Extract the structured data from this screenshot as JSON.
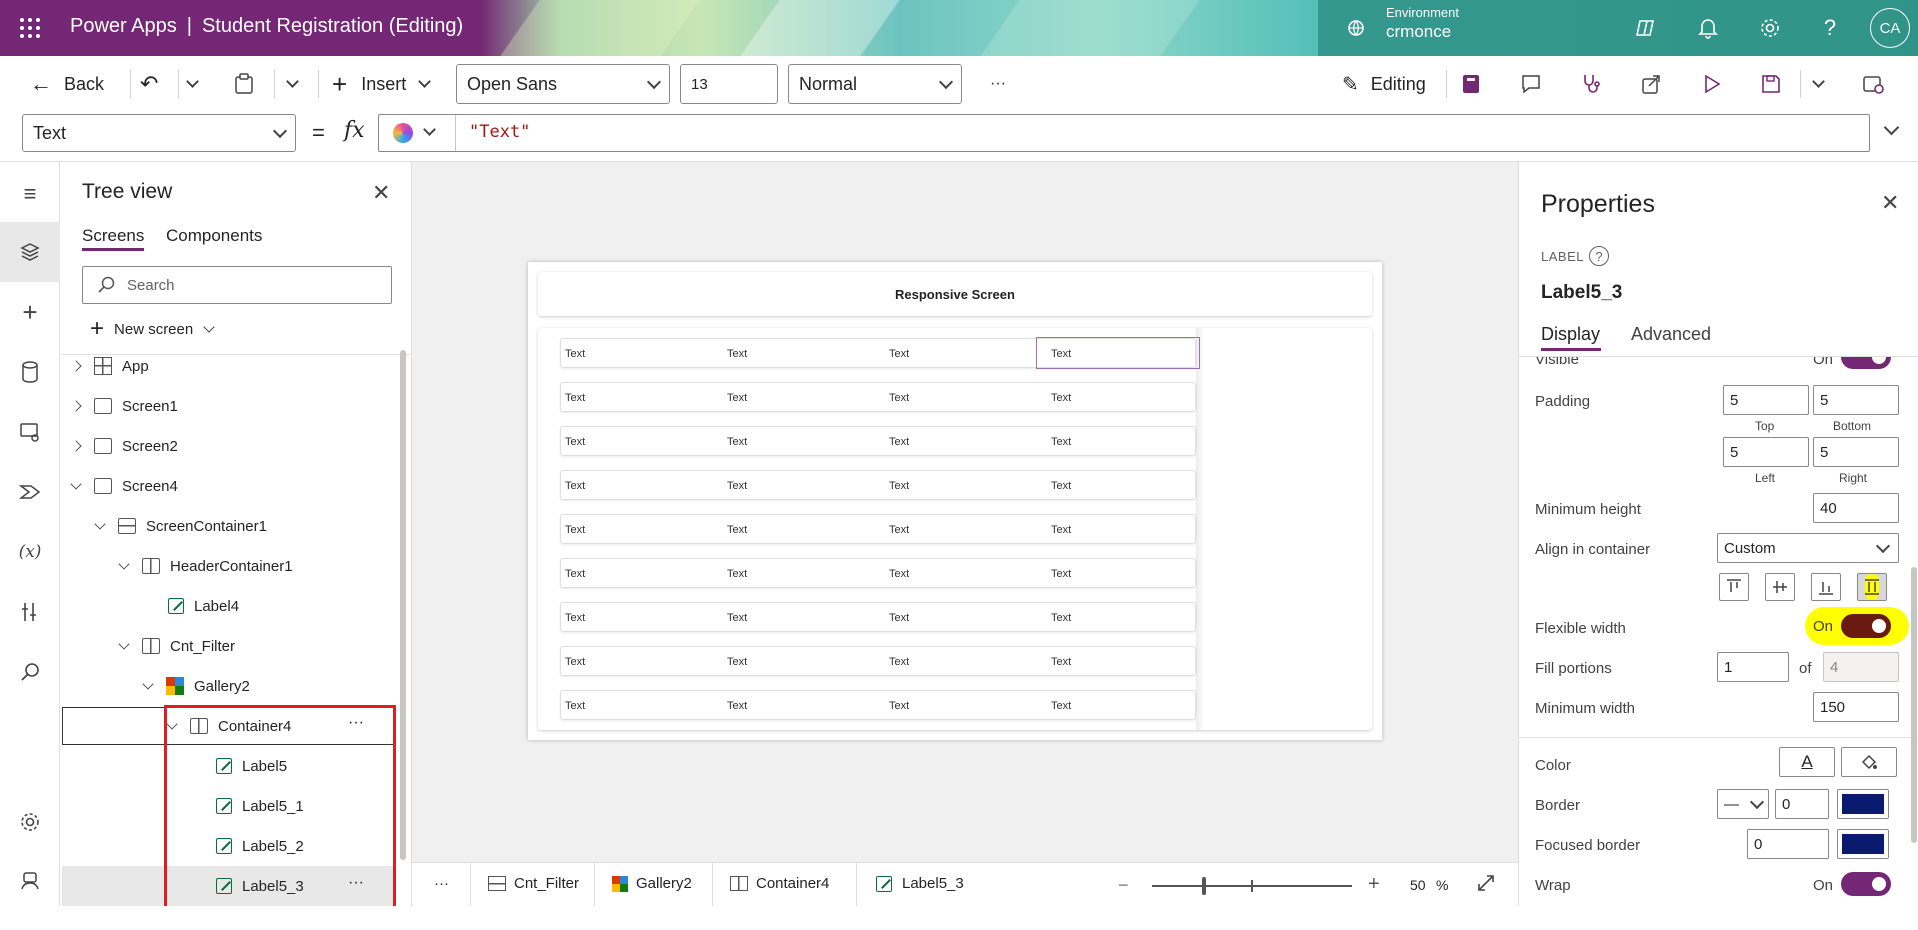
{
  "header": {
    "app": "Power Apps",
    "separator": "|",
    "title": "Student Registration (Editing)",
    "env_label": "Environment",
    "env_name": "crmonce",
    "avatar": "CA"
  },
  "toolbar": {
    "back": "Back",
    "insert": "Insert",
    "font": "Open Sans",
    "size": "13",
    "weight": "Normal",
    "more": "···",
    "editing": "Editing"
  },
  "formula": {
    "property": "Text",
    "eq": "=",
    "fx": "fx",
    "value": "\"Text\""
  },
  "tree": {
    "title": "Tree view",
    "tabs": [
      "Screens",
      "Components"
    ],
    "search_placeholder": "Search",
    "new_screen": "New screen",
    "nodes": [
      {
        "label": "App"
      },
      {
        "label": "Screen1"
      },
      {
        "label": "Screen2"
      },
      {
        "label": "Screen4"
      },
      {
        "label": "ScreenContainer1"
      },
      {
        "label": "HeaderContainer1"
      },
      {
        "label": "Label4"
      },
      {
        "label": "Cnt_Filter"
      },
      {
        "label": "Gallery2"
      },
      {
        "label": "Container4"
      },
      {
        "label": "Label5"
      },
      {
        "label": "Label5_1"
      },
      {
        "label": "Label5_2"
      },
      {
        "label": "Label5_3"
      }
    ],
    "dots": "···"
  },
  "canvas": {
    "screen_title": "Responsive Screen",
    "cell_text": "Text"
  },
  "breadcrumb": {
    "more": "···",
    "items": [
      "Cnt_Filter",
      "Gallery2",
      "Container4",
      "Label5_3"
    ],
    "zoom": "50",
    "zoom_unit": "%"
  },
  "props": {
    "title": "Properties",
    "type": "LABEL",
    "name": "Label5_3",
    "tabs": [
      "Display",
      "Advanced"
    ],
    "visible_label": "Visible",
    "on": "On",
    "padding_label": "Padding",
    "padding": {
      "top": "5",
      "bottom": "5",
      "left": "5",
      "right": "5"
    },
    "pad_sub": {
      "top": "Top",
      "bottom": "Bottom",
      "left": "Left",
      "right": "Right"
    },
    "min_height_label": "Minimum height",
    "min_height": "40",
    "align_label": "Align in container",
    "align_value": "Custom",
    "flex_width_label": "Flexible width",
    "fill_label": "Fill portions",
    "fill_value": "1",
    "fill_of": "of",
    "fill_total": "4",
    "min_width_label": "Minimum width",
    "min_width": "150",
    "color_label": "Color",
    "color_glyph": "A",
    "border_label": "Border",
    "border_value": "0",
    "border_style": "—",
    "focused_border_label": "Focused border",
    "focused_border_value": "0",
    "wrap_label": "Wrap",
    "border_color": "#0a1a6e"
  },
  "colors": {
    "brand": "#742774",
    "highlight": "#ffff00",
    "annotation_red": "#e01e1e"
  }
}
